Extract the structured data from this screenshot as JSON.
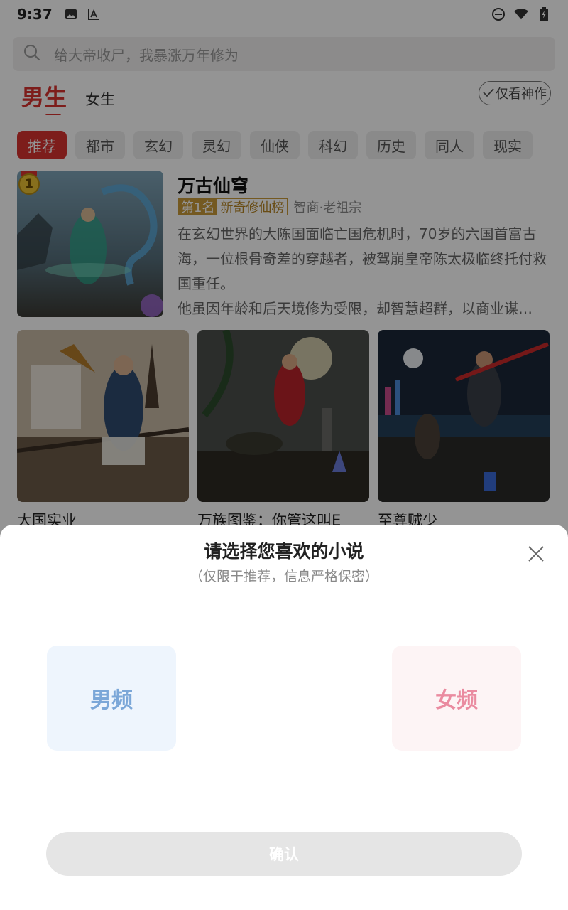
{
  "status_bar": {
    "time": "9:37",
    "left_icons": [
      "image-icon",
      "font-icon"
    ],
    "right_icons": [
      "dnd-icon",
      "wifi-icon",
      "battery-icon"
    ]
  },
  "search": {
    "placeholder": "给大帝收尸，我暴涨万年修为"
  },
  "gender_tabs": {
    "male": "男生",
    "female": "女生"
  },
  "masterpiece_toggle": "仅看神作",
  "categories": [
    "推荐",
    "都市",
    "玄幻",
    "灵幻",
    "仙侠",
    "科幻",
    "历史",
    "同人",
    "现实"
  ],
  "featured": {
    "rank_number": "1",
    "title": "万古仙穹",
    "rank_tag": "第1名",
    "rank_list": "新奇修仙榜",
    "author": "智商·老祖宗",
    "desc": "在玄幻世界的大陈国面临亡国危机时，70岁的六国首富古海，一位根骨奇差的穿越者，被驾崩皇帝陈太极临终托付救国重任。",
    "desc2": "他虽因年龄和后天境修为受限，却智慧超群，以商业谋…"
  },
  "grid_books": [
    {
      "title": "大国实业"
    },
    {
      "title": "万族图鉴：你管这叫E"
    },
    {
      "title": "至尊贼少"
    }
  ],
  "sheet": {
    "title": "请选择您喜欢的小说",
    "subtitle": "（仅限于推荐，信息严格保密）",
    "male_option": "男频",
    "female_option": "女频",
    "confirm": "确认"
  },
  "colors": {
    "accent": "#d8332f",
    "male_option_bg": "#eef5fd",
    "male_option_text": "#7ba7d8",
    "female_option_bg": "#fdf4f5",
    "female_option_text": "#ea8ba0"
  }
}
